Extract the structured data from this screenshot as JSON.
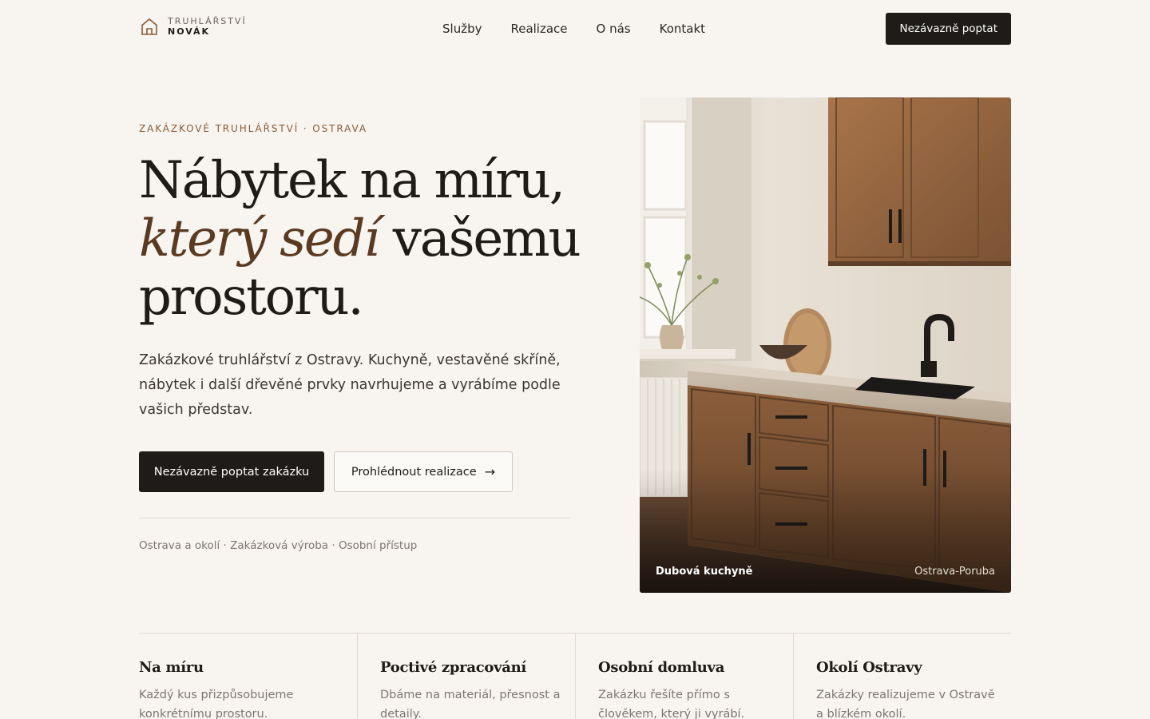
{
  "brand": {
    "line1": "TRUHLÁŘSTVÍ",
    "line2": "NOVÁK",
    "icon": "house-icon"
  },
  "nav": {
    "items": [
      {
        "label": "Služby"
      },
      {
        "label": "Realizace"
      },
      {
        "label": "O nás"
      },
      {
        "label": "Kontakt"
      }
    ],
    "cta": "Nezávazně poptat"
  },
  "hero": {
    "eyebrow": "ZAKÁZKOVÉ TRUHLÁŘSTVÍ · OSTRAVA",
    "headline_1": "Nábytek na míru,",
    "headline_accent": "který sedí",
    "headline_2": " vašemu",
    "headline_3": "prostoru.",
    "description": "Zakázkové truhlářství z Ostravy. Kuchyně, vestavěné skříně, nábytek i další dřevěné prvky navrhujeme a vyrábíme podle vašich představ.",
    "primary_button": "Nezávazně poptat zakázku",
    "secondary_button": "Prohlédnout realizace",
    "secondary_icon": "arrow-right-icon",
    "meta": "Ostrava a okolí · Zakázková výroba · Osobní přístup"
  },
  "image": {
    "caption_title": "Dubová kuchyně",
    "caption_location": "Ostrava-Poruba"
  },
  "features": [
    {
      "title": "Na míru",
      "text": "Každý kus přizpůsobujeme konkrétnímu prostoru."
    },
    {
      "title": "Poctivé zpracování",
      "text": "Dbáme na materiál, přesnost a detaily."
    },
    {
      "title": "Osobní domluva",
      "text": "Zakázku řešíte přímo s člověkem, který ji vyrábí."
    },
    {
      "title": "Okolí Ostravy",
      "text": "Zakázky realizujeme v Ostravě a blízkém okolí."
    }
  ],
  "colors": {
    "background": "#f8f5f0",
    "primary_dark": "#1e1b18",
    "accent_brown": "#8a5a34",
    "headline_accent": "#5b3a22"
  }
}
